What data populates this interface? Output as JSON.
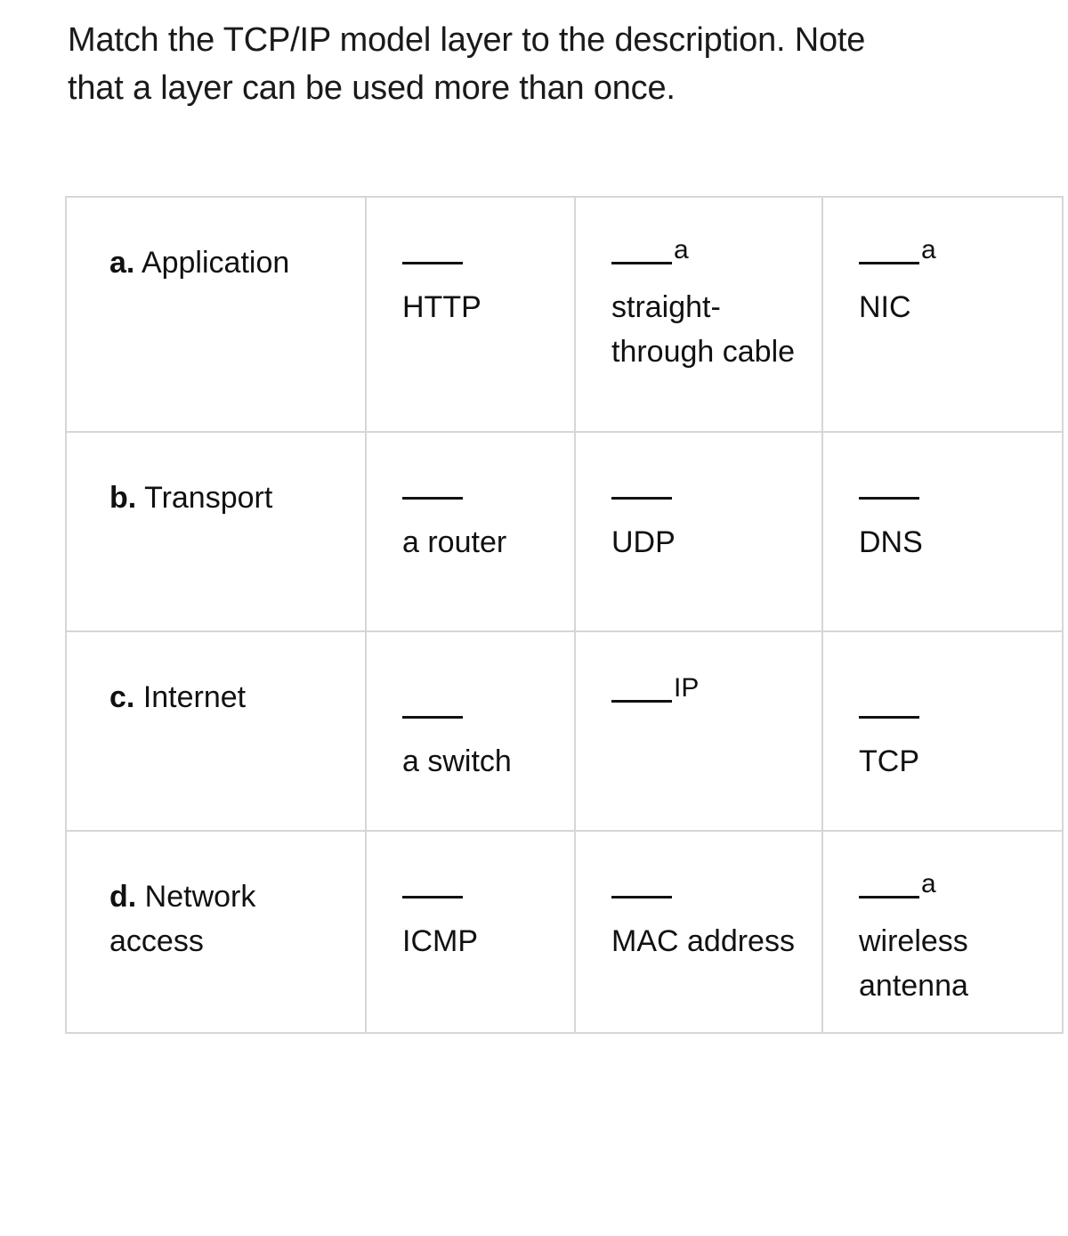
{
  "prompt": {
    "text": "Match the TCP/IP model layer to the description. Note that a layer can be used more than once."
  },
  "blank_glyph": "____",
  "table": {
    "rows": [
      {
        "layer": {
          "marker": "a.",
          "name": "Application"
        },
        "items": [
          {
            "blank": "____",
            "text": "HTTP",
            "inline_after_blank": "",
            "layout": "blank-above"
          },
          {
            "blank": "____",
            "text": "straight-through cable",
            "inline_after_blank": "a",
            "layout": "inline-a"
          },
          {
            "blank": "____",
            "text": "NIC",
            "inline_after_blank": "a",
            "layout": "inline-a"
          }
        ]
      },
      {
        "layer": {
          "marker": "b.",
          "name": "Transport"
        },
        "items": [
          {
            "blank": "____",
            "text": "a router",
            "inline_after_blank": "",
            "layout": "blank-above"
          },
          {
            "blank": "____",
            "text": "UDP",
            "inline_after_blank": "",
            "layout": "blank-above"
          },
          {
            "blank": "____",
            "text": "DNS",
            "inline_after_blank": "",
            "layout": "blank-above"
          }
        ]
      },
      {
        "layer": {
          "marker": "c.",
          "name": "Internet"
        },
        "items": [
          {
            "blank": "____",
            "text": "a switch",
            "inline_after_blank": "",
            "layout": "blank-above"
          },
          {
            "blank": "____",
            "text": "",
            "inline_after_blank": "IP",
            "layout": "inline-only"
          },
          {
            "blank": "____",
            "text": "TCP",
            "inline_after_blank": "",
            "layout": "blank-above"
          }
        ]
      },
      {
        "layer": {
          "marker": "d.",
          "name": "Network access"
        },
        "items": [
          {
            "blank": "____",
            "text": "ICMP",
            "inline_after_blank": "",
            "layout": "blank-above"
          },
          {
            "blank": "____",
            "text": "MAC address",
            "inline_after_blank": "",
            "layout": "blank-above"
          },
          {
            "blank": "____",
            "text": "wireless antenna",
            "inline_after_blank": "a",
            "layout": "inline-a"
          }
        ]
      }
    ]
  }
}
